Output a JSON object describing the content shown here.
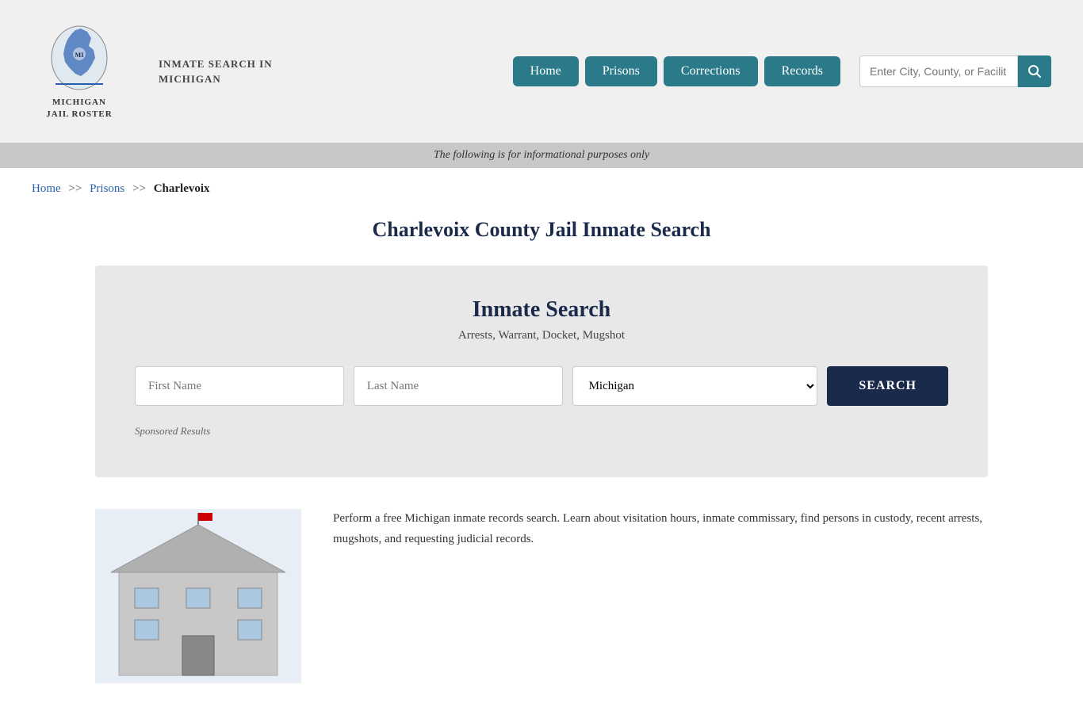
{
  "header": {
    "logo_line1": "MICHIGAN",
    "logo_line2": "JAIL ROSTER",
    "site_title": "INMATE SEARCH IN\nMICHIGAN",
    "nav": {
      "home": "Home",
      "prisons": "Prisons",
      "corrections": "Corrections",
      "records": "Records"
    },
    "search_placeholder": "Enter City, County, or Facilit"
  },
  "info_bar": {
    "text": "The following is for informational purposes only"
  },
  "breadcrumb": {
    "home": "Home",
    "separator1": ">>",
    "prisons": "Prisons",
    "separator2": ">>",
    "current": "Charlevoix"
  },
  "page_title": "Charlevoix County Jail Inmate Search",
  "search_card": {
    "title": "Inmate Search",
    "subtitle": "Arrests, Warrant, Docket, Mugshot",
    "first_name_placeholder": "First Name",
    "last_name_placeholder": "Last Name",
    "state_default": "Michigan",
    "search_button": "SEARCH",
    "sponsored_label": "Sponsored Results"
  },
  "bottom_text": "Perform a free Michigan inmate records search. Learn about visitation hours, inmate commissary, find persons in custody, recent arrests, mugshots, and requesting judicial records."
}
